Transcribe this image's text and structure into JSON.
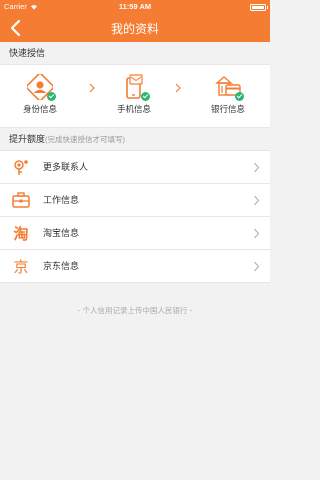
{
  "status_bar": {
    "carrier": "Carrier",
    "time": "11:59 AM"
  },
  "nav": {
    "title": "我的资料"
  },
  "quick_section": {
    "title": "快速授信",
    "items": [
      {
        "label": "身份信息",
        "icon": "id-card-icon",
        "verified": true
      },
      {
        "label": "手机信息",
        "icon": "phone-icon",
        "verified": true
      },
      {
        "label": "银行信息",
        "icon": "bank-card-icon",
        "verified": true
      }
    ]
  },
  "limit_section": {
    "title": "提升额度",
    "subtitle": "(完成快速授信才可填写)",
    "items": [
      {
        "label": "更多联系人",
        "icon": "contacts-icon"
      },
      {
        "label": "工作信息",
        "icon": "briefcase-icon"
      },
      {
        "label": "淘宝信息",
        "icon": "taobao-icon",
        "glyph": "淘"
      },
      {
        "label": "京东信息",
        "icon": "jd-icon",
        "glyph": "京"
      }
    ]
  },
  "footer": {
    "note": "- 个人信用记录上传中国人民银行 -"
  },
  "colors": {
    "accent": "#f47d33",
    "success": "#2bb673",
    "background": "#f2f2f2"
  }
}
